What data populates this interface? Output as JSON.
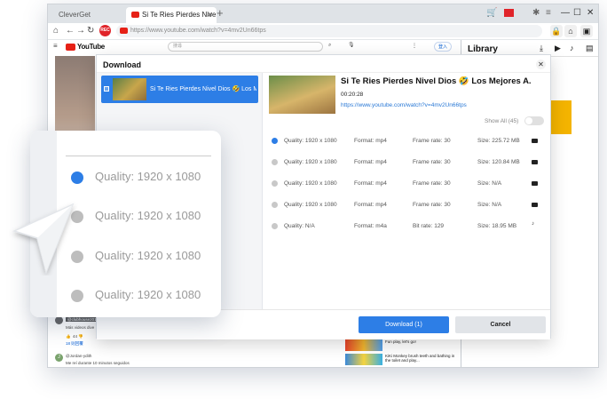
{
  "browser": {
    "tab_app": "CleverGet",
    "tab_active": "Si Te Ries Pierdes Nive",
    "tab_new": "+",
    "url": "https://www.youtube.com/watch?v=4mv2Un66tps",
    "rec_label": "REC"
  },
  "youtube": {
    "logo": "YouTube",
    "search_placeholder": "搜尋",
    "login": "登入",
    "comment1_name": "@clubhouse2010",
    "comment1_text": "Más videos dive",
    "comment1_likes": "44",
    "comment1_replies": "18 則回覆",
    "comment2_name": "@Jordan-ydith",
    "comment2_text": "Me reí durante 10 minutos seguidos",
    "related": [
      "Fun play, let's go!",
      "KiKi Monkey brush teeth and bathing in the toilet and play..."
    ]
  },
  "library": {
    "title": "Library"
  },
  "dialog": {
    "title": "Download",
    "close": "✕",
    "item_title": "Si Te Ries Pierdes Nivel Dios 🤣 Los Mejores A.",
    "video_title": "Si Te Ries Pierdes Nivel Dios 🤣 Los Mejores A.",
    "duration": "00:20:28",
    "url": "https://www.youtube.com/watch?v=4mv2Un66tps",
    "show_all": "Show All (45)",
    "rows": [
      {
        "quality": "Quality: 1920 x 1080",
        "format": "Format: mp4",
        "rate": "Frame rate: 30",
        "size": "Size: 225.72 MB"
      },
      {
        "quality": "Quality: 1920 x 1080",
        "format": "Format: mp4",
        "rate": "Frame rate: 30",
        "size": "Size: 120.84 MB"
      },
      {
        "quality": "Quality: 1920 x 1080",
        "format": "Format: mp4",
        "rate": "Frame rate: 30",
        "size": "Size: N/A"
      },
      {
        "quality": "Quality: 1920 x 1080",
        "format": "Format: mp4",
        "rate": "Frame rate: 30",
        "size": "Size: N/A"
      },
      {
        "quality": "Quality: N/A",
        "format": "Format: m4a",
        "rate": "Bit rate: 129",
        "size": "Size: 18.95 MB"
      }
    ],
    "download_button": "Download (1)",
    "cancel_button": "Cancel"
  },
  "zoom": {
    "options": [
      "Quality: 1920 x 1080",
      "Quality: 1920 x 1080",
      "Quality: 1920 x 1080",
      "Quality: 1920 x 1080"
    ]
  }
}
